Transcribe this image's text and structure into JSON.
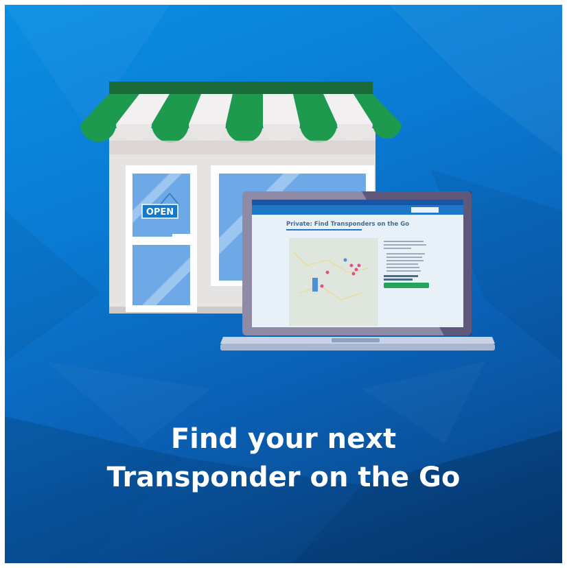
{
  "headline": {
    "line1": "Find your next",
    "line2": "Transponder on the Go"
  },
  "store": {
    "sign_text": "OPEN"
  },
  "laptop_screen": {
    "page_title": "Private: Find Transponders on the Go"
  },
  "colors": {
    "background_light": "#0a8fe3",
    "background_dark": "#083f7e",
    "awning_green": "#1e9a4e",
    "awning_dark_green": "#1b6b3a",
    "sign_blue": "#1479c9",
    "laptop_frame": "#8f8aa6",
    "screen_nav": "#1f77c8"
  }
}
